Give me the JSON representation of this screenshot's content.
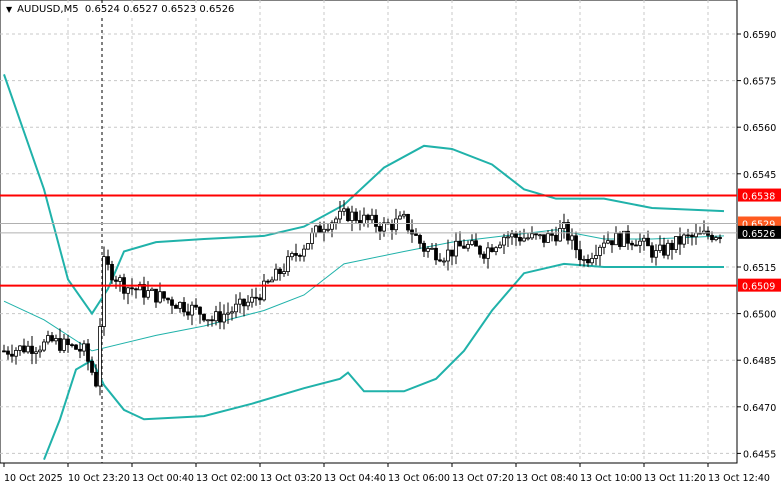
{
  "header": {
    "symbol": "AUDUSD,M5",
    "ohlc": "0.6524 0.6527 0.6523 0.6526",
    "menu_icon": "triangle-down-icon"
  },
  "chart_data": {
    "type": "candlestick",
    "symbol": "AUDUSD",
    "timeframe": "M5",
    "ylim": [
      0.6441,
      0.6601
    ],
    "price_ticks": [
      "0.6590",
      "0.6575",
      "0.6560",
      "0.6545",
      "0.6515",
      "0.6500",
      "0.6485",
      "0.6470",
      "0.6455"
    ],
    "time_ticks": [
      "10 Oct 2025",
      "10 Oct 23:20",
      "13 Oct 00:40",
      "13 Oct 02:00",
      "13 Oct 03:20",
      "13 Oct 04:40",
      "13 Oct 06:00",
      "13 Oct 07:20",
      "13 Oct 08:40",
      "13 Oct 10:00",
      "13 Oct 11:20",
      "13 Oct 12:40"
    ],
    "bars_per_tick": 16,
    "close_waypoints": [
      [
        0,
        0.6488
      ],
      [
        10,
        0.649
      ],
      [
        12,
        0.6491
      ],
      [
        20,
        0.6488
      ],
      [
        23,
        0.6478
      ],
      [
        25,
        0.6516
      ],
      [
        30,
        0.6509
      ],
      [
        40,
        0.6505
      ],
      [
        50,
        0.65
      ],
      [
        52,
        0.6498
      ],
      [
        62,
        0.6504
      ],
      [
        68,
        0.6512
      ],
      [
        75,
        0.6522
      ],
      [
        80,
        0.6529
      ],
      [
        86,
        0.6532
      ],
      [
        95,
        0.6528
      ],
      [
        100,
        0.653
      ],
      [
        105,
        0.6521
      ],
      [
        110,
        0.6519
      ],
      [
        115,
        0.6522
      ],
      [
        120,
        0.652
      ],
      [
        125,
        0.6525
      ],
      [
        135,
        0.6524
      ],
      [
        140,
        0.6527
      ],
      [
        145,
        0.6517
      ],
      [
        150,
        0.6524
      ],
      [
        158,
        0.6524
      ],
      [
        163,
        0.6519
      ],
      [
        170,
        0.6524
      ],
      [
        179,
        0.6526
      ]
    ],
    "bands": {
      "color": "#20b2aa",
      "upper": [
        [
          0,
          0.6577
        ],
        [
          10,
          0.654
        ],
        [
          16,
          0.6511
        ],
        [
          22,
          0.65
        ],
        [
          26,
          0.6508
        ],
        [
          30,
          0.652
        ],
        [
          38,
          0.6523
        ],
        [
          50,
          0.6524
        ],
        [
          65,
          0.6525
        ],
        [
          75,
          0.6528
        ],
        [
          85,
          0.6535
        ],
        [
          95,
          0.6547
        ],
        [
          105,
          0.6554
        ],
        [
          112,
          0.6553
        ],
        [
          122,
          0.6548
        ],
        [
          130,
          0.654
        ],
        [
          138,
          0.6537
        ],
        [
          150,
          0.6537
        ],
        [
          162,
          0.6534
        ],
        [
          180,
          0.6533
        ]
      ],
      "middle": [
        [
          0,
          0.6504
        ],
        [
          10,
          0.6498
        ],
        [
          22,
          0.6488
        ],
        [
          38,
          0.6493
        ],
        [
          50,
          0.6496
        ],
        [
          65,
          0.6501
        ],
        [
          75,
          0.6506
        ],
        [
          85,
          0.6516
        ],
        [
          100,
          0.652
        ],
        [
          112,
          0.6523
        ],
        [
          125,
          0.6525
        ],
        [
          138,
          0.6527
        ],
        [
          150,
          0.6524
        ],
        [
          162,
          0.6524
        ],
        [
          180,
          0.6525
        ]
      ],
      "lower": [
        [
          10,
          0.6453
        ],
        [
          14,
          0.6466
        ],
        [
          18,
          0.6482
        ],
        [
          22,
          0.6485
        ],
        [
          25,
          0.6477
        ],
        [
          30,
          0.6469
        ],
        [
          35,
          0.6466
        ],
        [
          50,
          0.6467
        ],
        [
          62,
          0.6471
        ],
        [
          75,
          0.6476
        ],
        [
          84,
          0.6479
        ],
        [
          86,
          0.6481
        ],
        [
          90,
          0.6475
        ],
        [
          100,
          0.6475
        ],
        [
          108,
          0.6479
        ],
        [
          115,
          0.6488
        ],
        [
          122,
          0.6501
        ],
        [
          130,
          0.6513
        ],
        [
          140,
          0.6516
        ],
        [
          150,
          0.6515
        ],
        [
          162,
          0.6515
        ],
        [
          180,
          0.6515
        ]
      ]
    },
    "levels": [
      {
        "price": 0.6538,
        "label": "0.6538",
        "color": "#ff0000"
      },
      {
        "price": 0.6509,
        "label": "0.6509",
        "color": "#ff0000"
      }
    ],
    "ask_line": {
      "price": 0.6529,
      "label": "0.6529",
      "color": "#ff5a1f"
    },
    "bid_line": {
      "price": 0.6526,
      "label": "0.6526",
      "color": "#000000"
    },
    "session_separator_bar": 24.5
  }
}
